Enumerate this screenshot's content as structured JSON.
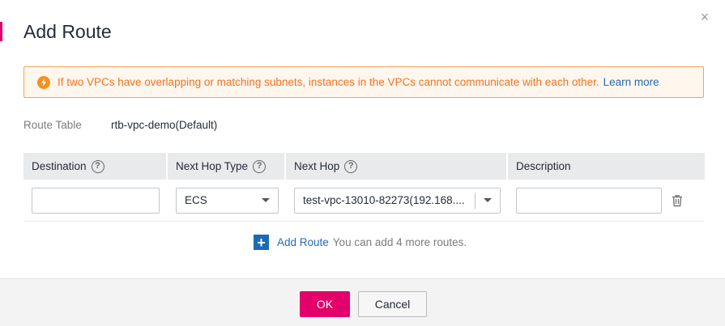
{
  "dialog": {
    "title": "Add Route",
    "close_glyph": "×"
  },
  "notice": {
    "icon": "alert-circle-icon",
    "icon_glyph": "!",
    "text": "If two VPCs have overlapping or matching subnets, instances in the VPCs cannot communicate with each other.",
    "link": "Learn more",
    "colors": {
      "text": "#f37320",
      "border": "#f6a15a",
      "link": "#256ab4"
    }
  },
  "route_table": {
    "label": "Route Table",
    "value": "rtb-vpc-demo(Default)"
  },
  "table": {
    "headers": [
      {
        "label": "Destination",
        "help": "?"
      },
      {
        "label": "Next Hop Type",
        "help": "?"
      },
      {
        "label": "Next Hop",
        "help": "?"
      },
      {
        "label": "Description",
        "help": ""
      }
    ],
    "rows": [
      {
        "destination": "",
        "next_hop_type": "ECS",
        "next_hop": "test-vpc-13010-82273(192.168....",
        "description": ""
      }
    ]
  },
  "add_route": {
    "icon_glyph": "+",
    "link": "Add Route",
    "hint": "You can add 4 more routes."
  },
  "footer": {
    "ok_label": "OK",
    "cancel_label": "Cancel",
    "accent_color": "#e3006b"
  }
}
